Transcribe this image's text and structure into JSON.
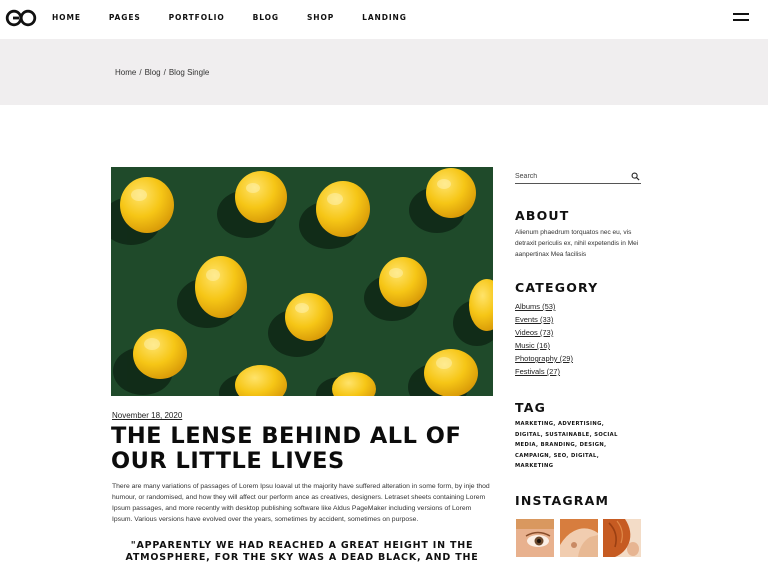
{
  "header": {
    "logo_icon": "infinity-loop-logo",
    "nav": [
      "HOME",
      "PAGES",
      "PORTFOLIO",
      "BLOG",
      "SHOP",
      "LANDING"
    ],
    "menu_icon": "hamburger-menu-icon"
  },
  "breadcrumb": {
    "items": [
      "Home",
      "Blog",
      "Blog Single"
    ],
    "separator": "/"
  },
  "post": {
    "image_icon": "lemons-on-green-photo",
    "date": "November 18, 2020",
    "title": "THE LENSE BEHIND ALL OF OUR LITTLE LIVES",
    "body": "There are many variations of passages of Lorem Ipsu loaval ut the majority have suffered alteration in some form, by inje thod humour, or randomised, and how they will affect our perform ance as creatives, designers. Letraset sheets containing Lorem Ipsum passages, and more recently with desktop publishing software like Aldus PageMaker including versions of Lorem Ipsum. Various versions have evolved over the years, sometimes by accident, sometimes on purpose.",
    "quote": "\"APPARENTLY WE HAD REACHED A GREAT HEIGHT IN THE ATMOSPHERE, FOR THE SKY WAS A DEAD BLACK, AND THE"
  },
  "sidebar": {
    "search": {
      "placeholder": "Search",
      "icon": "search-icon"
    },
    "about": {
      "heading": "ABOUT",
      "text": "Alienum phaedrum torquatos nec eu, vis detraxit periculis ex, nihil expetendis in Mei aanpertinax Mea facilisis"
    },
    "category": {
      "heading": "CATEGORY",
      "items": [
        "Albums (53)",
        "Events  (33)",
        "Videos (73)",
        "Music (16)",
        "Photography (29)",
        "Festivals (27)"
      ]
    },
    "tag": {
      "heading": "TAG",
      "items": [
        "MARKETING,",
        "ADVERTISING,",
        "DIGITAL,",
        "SUSTAINABLE,",
        "SOCIAL MEDIA,",
        "BRANDING,",
        "DESIGN,",
        "CAMPAIGN,",
        "SEO,",
        "DIGITAL,",
        "MARKETING"
      ]
    },
    "instagram": {
      "heading": "INSTAGRAM",
      "thumbs": [
        "instagram-eye-photo",
        "instagram-portrait-photo",
        "instagram-hair-photo"
      ]
    }
  },
  "colors": {
    "title_band": "#f0eeef",
    "photo_green": "#1f4a2a",
    "lemon_yellow": "#f6c616",
    "text_dark": "#111111"
  }
}
